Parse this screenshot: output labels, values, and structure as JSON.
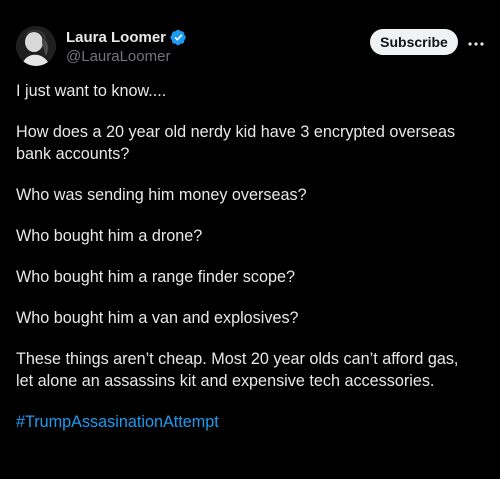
{
  "author": {
    "display_name": "Laura Loomer",
    "handle": "@LauraLoomer",
    "verified": true
  },
  "actions": {
    "subscribe_label": "Subscribe"
  },
  "post": {
    "lines": {
      "p1": "I just want to know....",
      "p2a": "How does a 20 year old nerdy kid have 3 encrypted overseas",
      "p2b": "bank accounts?",
      "p3": "Who was sending him money overseas?",
      "p4": "Who bought him a drone?",
      "p5": "Who bought him a range finder scope?",
      "p6": "Who bought him a van and explosives?",
      "p7a": "These things aren’t cheap. Most 20 year olds can’t afford gas,",
      "p7b": "let alone an assassins kit and expensive tech accessories."
    },
    "hashtag": "#TrumpAssasinationAttempt"
  },
  "colors": {
    "background": "#000000",
    "text": "#e7e9ea",
    "secondary_text": "#71767b",
    "link": "#1d9bf0",
    "verified_badge": "#1d9bf0",
    "subscribe_bg": "#eff3f4"
  },
  "icons": {
    "verified": "verified-badge-icon",
    "more": "more-options-icon"
  }
}
